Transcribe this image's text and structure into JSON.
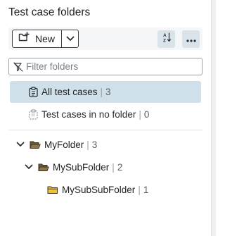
{
  "panel": {
    "title": "Test case folders"
  },
  "toolbar": {
    "new_label": "New",
    "caret_icon": "chevron-down-icon",
    "sort_icon": "sort-az-icon",
    "more_icon": "more-horizontal-icon"
  },
  "filter": {
    "placeholder": "Filter folders",
    "value": ""
  },
  "special": {
    "all": {
      "label": "All test cases",
      "count": "3"
    },
    "nofolder": {
      "label": "Test cases in no folder",
      "count": "0"
    }
  },
  "tree": [
    {
      "label": "MyFolder",
      "count": "3",
      "expanded": true
    },
    {
      "label": "MySubFolder",
      "count": "2",
      "expanded": true
    },
    {
      "label": "MySubSubFolder",
      "count": "1"
    }
  ],
  "colors": {
    "selected_bg": "#cfe0ea",
    "toolbar_bg": "#f4f6f7",
    "icon_button_bg": "#d9e4ea",
    "folder_open": "#6b5a3a",
    "folder_leaf": "#f2c12e"
  }
}
